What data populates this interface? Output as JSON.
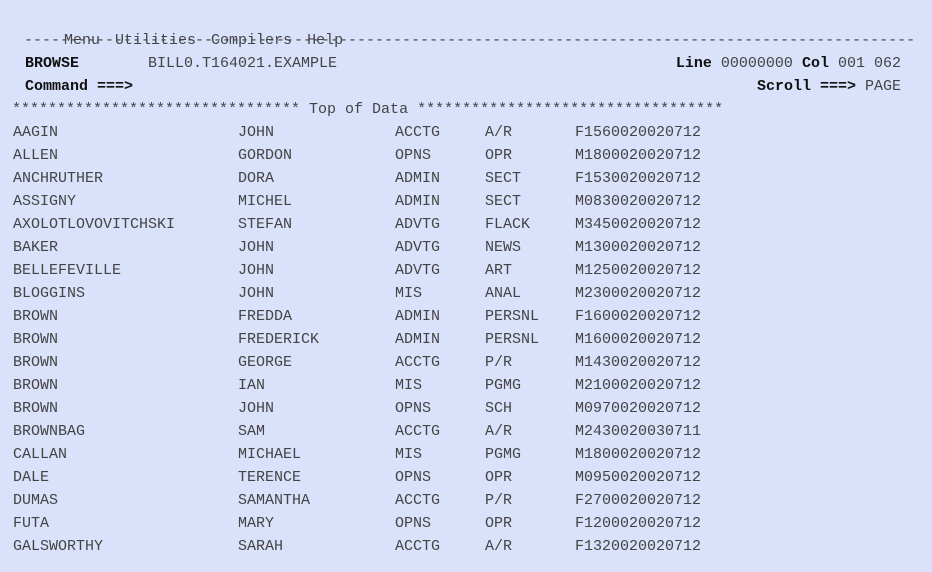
{
  "menu": [
    "Menu",
    "Utilities",
    "Compilers",
    "Help"
  ],
  "separator": "---------------------------------------------------------------------------------------------------",
  "header": {
    "mode": "BROWSE",
    "dataset": "BILL0.T164021.EXAMPLE",
    "line_label": "Line",
    "line_value": "00000000",
    "col_label": "Col",
    "col_value": "001 062",
    "command_label": "Command ===>",
    "command_value": "",
    "scroll_label": "Scroll ===>",
    "scroll_value": "PAGE"
  },
  "top_of_data": "******************************** Top of Data **********************************",
  "rows": [
    [
      "AAGIN",
      "JOHN",
      "ACCTG",
      "A/R",
      "F1560020020712"
    ],
    [
      "ALLEN",
      "GORDON",
      "OPNS",
      "OPR",
      "M1800020020712"
    ],
    [
      "ANCHRUTHER",
      "DORA",
      "ADMIN",
      "SECT",
      "F1530020020712"
    ],
    [
      "ASSIGNY",
      "MICHEL",
      "ADMIN",
      "SECT",
      "M0830020020712"
    ],
    [
      "AXOLOTLOVOVITCHSKI",
      "STEFAN",
      "ADVTG",
      "FLACK",
      "M3450020020712"
    ],
    [
      "BAKER",
      "JOHN",
      "ADVTG",
      "NEWS",
      "M1300020020712"
    ],
    [
      "BELLEFEVILLE",
      "JOHN",
      "ADVTG",
      "ART",
      "M1250020020712"
    ],
    [
      "BLOGGINS",
      "JOHN",
      "MIS",
      "ANAL",
      "M2300020020712"
    ],
    [
      "BROWN",
      "FREDDA",
      "ADMIN",
      "PERSNL",
      "F1600020020712"
    ],
    [
      "BROWN",
      "FREDERICK",
      "ADMIN",
      "PERSNL",
      "M1600020020712"
    ],
    [
      "BROWN",
      "GEORGE",
      "ACCTG",
      "P/R",
      "M1430020020712"
    ],
    [
      "BROWN",
      "IAN",
      "MIS",
      "PGMG",
      "M2100020020712"
    ],
    [
      "BROWN",
      "JOHN",
      "OPNS",
      "SCH",
      "M0970020020712"
    ],
    [
      "BROWNBAG",
      "SAM",
      "ACCTG",
      "A/R",
      "M2430020030711"
    ],
    [
      "CALLAN",
      "MICHAEL",
      "MIS",
      "PGMG",
      "M1800020020712"
    ],
    [
      "DALE",
      "TERENCE",
      "OPNS",
      "OPR",
      "M0950020020712"
    ],
    [
      "DUMAS",
      "SAMANTHA",
      "ACCTG",
      "P/R",
      "F2700020020712"
    ],
    [
      "FUTA",
      "MARY",
      "OPNS",
      "OPR",
      "F1200020020712"
    ],
    [
      "GALSWORTHY",
      "SARAH",
      "ACCTG",
      "A/R",
      "F1320020020712"
    ]
  ]
}
